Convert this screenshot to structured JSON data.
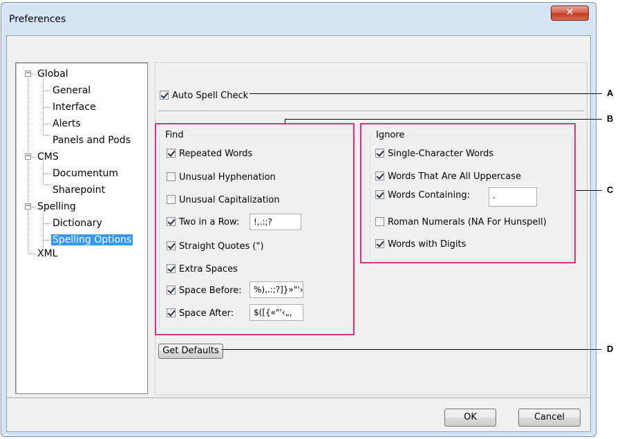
{
  "window": {
    "title": "Preferences",
    "close_glyph": "✕"
  },
  "tree": {
    "items": [
      {
        "label": "Global",
        "expander": "−"
      },
      {
        "label": "General"
      },
      {
        "label": "Interface"
      },
      {
        "label": "Alerts"
      },
      {
        "label": "Panels and Pods"
      },
      {
        "label": "CMS",
        "expander": "−"
      },
      {
        "label": "Documentum"
      },
      {
        "label": "Sharepoint"
      },
      {
        "label": "Spelling",
        "expander": "−"
      },
      {
        "label": "Dictionary"
      },
      {
        "label": "Spelling Options",
        "selected": true
      },
      {
        "label": "XML"
      }
    ]
  },
  "auto_spell": {
    "label": "Auto Spell Check",
    "checked": true
  },
  "find": {
    "title": "Find",
    "options": [
      {
        "label": "Repeated Words",
        "checked": true
      },
      {
        "label": "Unusual Hyphenation",
        "checked": false
      },
      {
        "label": "Unusual Capitalization",
        "checked": false
      },
      {
        "label": "Two in a Row:",
        "checked": true,
        "value": "!,.:;?"
      },
      {
        "label": "Straight Quotes (\")",
        "checked": true
      },
      {
        "label": "Extra Spaces",
        "checked": true
      },
      {
        "label": "Space Before:",
        "checked": true,
        "value": "%),.:;?]}»\"'›"
      },
      {
        "label": "Space After:",
        "checked": true,
        "value": "$([{«\"'‹„‚"
      }
    ]
  },
  "ignore": {
    "title": "Ignore",
    "options": [
      {
        "label": "Single-Character Words",
        "checked": true
      },
      {
        "label": "Words That Are All Uppercase",
        "checked": true
      },
      {
        "label": "Words Containing:",
        "checked": true,
        "value": "."
      },
      {
        "label": "Roman Numerals (NA For Hunspell)",
        "checked": false
      },
      {
        "label": "Words with Digits",
        "checked": true
      }
    ]
  },
  "buttons": {
    "get_defaults": "Get Defaults",
    "ok": "OK",
    "cancel": "Cancel"
  },
  "callouts": {
    "a": "A",
    "b": "B",
    "c": "C",
    "d": "D"
  },
  "colors": {
    "highlight": "#d6337a",
    "selection": "#3399ff",
    "close_button": "#c8452f"
  }
}
